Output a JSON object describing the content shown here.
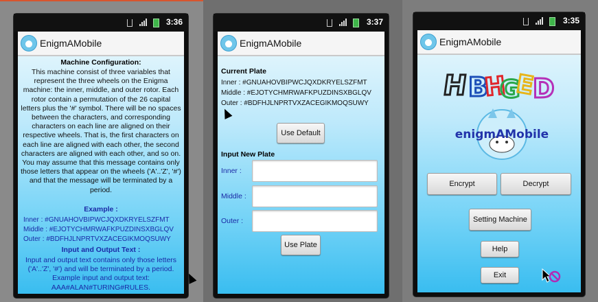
{
  "status": {
    "time1": "3:36",
    "time2": "3:37",
    "time3": "3:35"
  },
  "app_title": "EnigmAMobile",
  "screen1": {
    "heading": "Machine Configuration:",
    "description": "This machine consist of three variables that represent the three wheels on the Enigma machine: the inner, middle, and outer rotor. Each rotor contain a permutation of the 26 capital letters plus the '#' symbol. There will be no spaces between the characters, and corresponding characters on each line are aligned on their respective wheels. That is, the first characters on each line are aligned with each other, the second characters are aligned with each other, and so on. You may assume that this message contains only those letters that appear on the wheels ('A'..'Z', '#') and that the message will be terminated by a period.",
    "example_heading": "Example :",
    "example_inner": "Inner : #GNUAHOVBIPWCJQXDKRYELSZFMT",
    "example_middle": "Middle : #EJOTYCHMRWAFKPUZDINSXBGLQV",
    "example_outer": "Outer : #BDFHJLNPRTVXZACEGIKMOQSUWY",
    "io_heading": "Input and Output Text :",
    "io_text": "Input and output text contains only those letters ('A'..'Z', '#') and will be terminated by a period. Example input and output text: AAA#ALAN#TURING#RULES."
  },
  "screen2": {
    "current_plate_heading": "Current Plate",
    "inner": "Inner    : #GNUAHOVBIPWCJQXDKRYELSZFMT",
    "middle": "Middle : #EJOTYCHMRWAFKPUZDINSXBGLQV",
    "outer": "Outer    : #BDFHJLNPRTVXZACEGIKMOQSUWY",
    "use_default": "Use Default",
    "input_heading": "Input New Plate",
    "inner_label": "Inner     :",
    "middle_label": "Middle :",
    "outer_label": "Outer     :",
    "inner_value": "",
    "middle_value": "",
    "outer_value": "",
    "use_plate": "Use Plate"
  },
  "screen3": {
    "logo_text": "HBHGED",
    "brand_logo": "enigmAMobile",
    "encrypt": "Encrypt",
    "decrypt": "Decrypt",
    "setting_machine": "Setting Machine",
    "help": "Help",
    "exit": "Exit"
  }
}
